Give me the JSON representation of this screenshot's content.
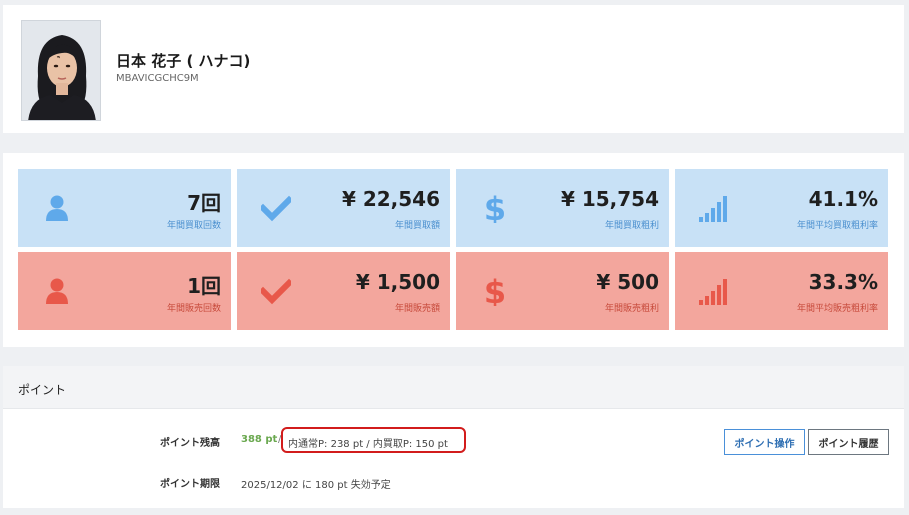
{
  "profile": {
    "name": "日本 花子 ( ハナコ)",
    "code": "MBAVICGCHC9M"
  },
  "colors": {
    "buy_tile": "#c8e1f6",
    "buy_icon": "#5fa9ea",
    "sell_tile": "#f3a69d",
    "sell_icon": "#e8584a",
    "balance_green": "#6aa84f",
    "highlight_red": "#d21c1c"
  },
  "stats": {
    "buy": [
      {
        "icon": "user-icon",
        "value": "7回",
        "label": "年間買取回数"
      },
      {
        "icon": "check-icon",
        "value": "¥ 22,546",
        "label": "年間買取額"
      },
      {
        "icon": "dollar-icon",
        "value": "¥ 15,754",
        "label": "年間買取粗利"
      },
      {
        "icon": "signal-bars-icon",
        "value": "41.1%",
        "label": "年間平均買取粗利率"
      }
    ],
    "sell": [
      {
        "icon": "user-icon",
        "value": "1回",
        "label": "年間販売回数"
      },
      {
        "icon": "check-icon",
        "value": "¥ 1,500",
        "label": "年間販売額"
      },
      {
        "icon": "dollar-icon",
        "value": "¥ 500",
        "label": "年間販売粗利"
      },
      {
        "icon": "signal-bars-icon",
        "value": "33.3%",
        "label": "年間平均販売粗利率"
      }
    ]
  },
  "points": {
    "title": "ポイント",
    "balance_label": "ポイント残高",
    "balance_value": "388 pt",
    "separator": "/",
    "breakdown": "内通常P: 238 pt / 内買取P: 150 pt",
    "expiry_label": "ポイント期限",
    "expiry_value": "2025/12/02 に 180 pt 失効予定",
    "operate_button": "ポイント操作",
    "history_button": "ポイント履歴"
  }
}
